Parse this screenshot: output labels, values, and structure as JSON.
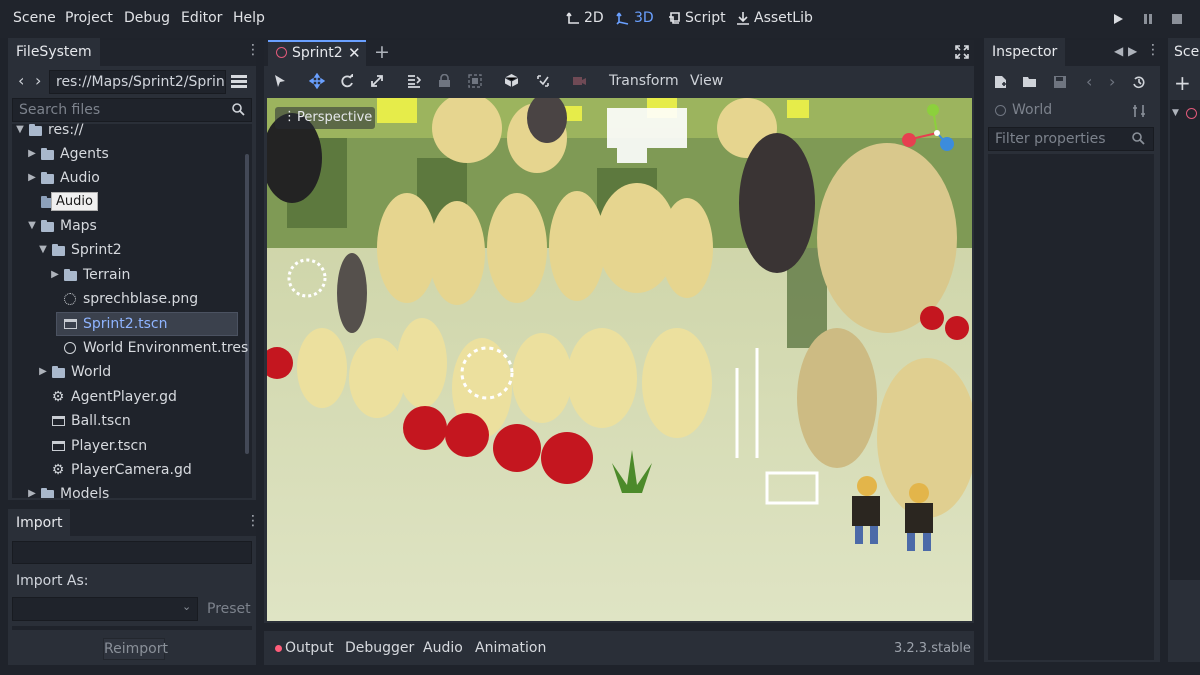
{
  "menu": {
    "items": [
      "Scene",
      "Project",
      "Debug",
      "Editor",
      "Help"
    ],
    "modes": {
      "m2d": "2D",
      "m3d": "3D",
      "script": "Script",
      "assetlib": "AssetLib"
    }
  },
  "filesystem": {
    "tab_label": "FileSystem",
    "path": "res://Maps/Sprint2/Sprint",
    "search_placeholder": "Search files",
    "tree": {
      "root": "res://",
      "agents": "Agents",
      "audio": "Audio",
      "maps": "Maps",
      "sprint2": "Sprint2",
      "terrain": "Terrain",
      "sprechblase": "sprechblase.png",
      "sprint2_tscn": "Sprint2.tscn",
      "world_env": "World Environment.tres",
      "world": "World",
      "agent_player": "AgentPlayer.gd",
      "ball": "Ball.tscn",
      "player": "Player.tscn",
      "player_camera": "PlayerCamera.gd",
      "models": "Models"
    },
    "tooltip": "Audio"
  },
  "import_panel": {
    "tab_label": "Import",
    "import_as_label": "Import As:",
    "preset_label": "Preset",
    "reimport_label": "Reimport"
  },
  "editor": {
    "scene_tab": "Sprint2",
    "toolbar": {
      "transform": "Transform",
      "view": "View"
    },
    "viewport_label": "Perspective"
  },
  "bottom": {
    "tabs": {
      "output": "Output",
      "debugger": "Debugger",
      "audio": "Audio",
      "animation": "Animation"
    },
    "version": "3.2.3.stable"
  },
  "inspector": {
    "tab_label": "Inspector",
    "object_label": "World",
    "filter_placeholder": "Filter properties"
  },
  "scene_dock": {
    "tab_label": "Scen"
  },
  "colors": {
    "accent": "#6aa0ff",
    "bg": "#20242c",
    "panel": "#2a2f38"
  }
}
